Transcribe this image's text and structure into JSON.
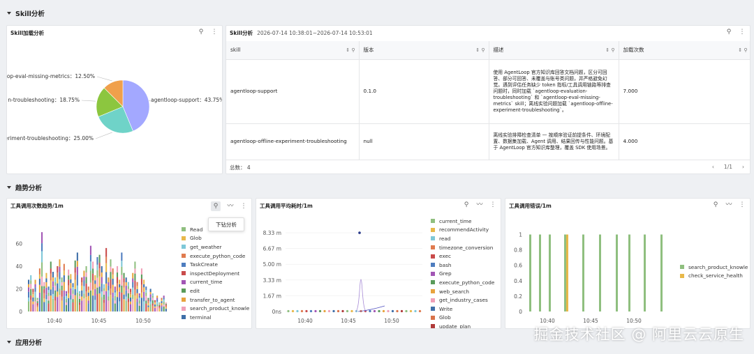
{
  "sections": {
    "skill": "Skill分析",
    "trend": "趋势分析",
    "app": "应用分析"
  },
  "pie_panel": {
    "title": "Skill加载分析"
  },
  "table_panel": {
    "title": "Skill分析",
    "range": "2026-07-14 10:38:01~2026-07-14 10:53:01",
    "columns": [
      "skill",
      "版本",
      "描述",
      "加载次数"
    ],
    "rows": [
      {
        "skill": "agentloop-support",
        "version": "0.1.0",
        "desc": "使用 AgentLoop 官方知识库回答文档问题，区分可回答、部分可回答、未覆盖与账号类问题，并严格避免幻觉。遇到评估任务缺少 token 指标/工具调用链路等排查问题时，同时加载 `agentloop-evaluation-troubleshooting` 和 `agentloop-eval-missing-metrics` skill；离线实验问题加载 `agentloop-offline-experiment-troubleshooting`。",
        "count": "7.000"
      },
      {
        "skill": "agentloop-offline-experiment-troubleshooting",
        "version": "null",
        "desc": "离线实验排障检查清单 — 按顺序验证前提条件、环境配置、数据集加载、Agent 调用、结果回传与性能问题。基于 AgentLoop 官方知识库整理，覆盖 SDK 使用场景。",
        "count": "4.000"
      }
    ],
    "total": "总数： 4",
    "page": "1/1"
  },
  "tool_count_panel": {
    "title": "工具调用次数趋势/1m",
    "tooltip": "下钻分析",
    "legend": [
      {
        "name": "Read",
        "color": "#8fbf7f"
      },
      {
        "name": "Glob",
        "color": "#e8b84a"
      },
      {
        "name": "get_weather",
        "color": "#7ec8d8"
      },
      {
        "name": "execute_python_code",
        "color": "#e07b4f"
      },
      {
        "name": "TaskCreate",
        "color": "#4e7dbf"
      },
      {
        "name": "inspectDeployment",
        "color": "#c94b4b"
      },
      {
        "name": "current_time",
        "color": "#a256b5"
      },
      {
        "name": "edit",
        "color": "#5a9b5a"
      },
      {
        "name": "transfer_to_agent",
        "color": "#e8a33d"
      },
      {
        "name": "search_product_knowle",
        "color": "#f0a0b8"
      },
      {
        "name": "terminal",
        "color": "#3f6fa8"
      }
    ]
  },
  "tool_latency_panel": {
    "title": "工具调用平均耗时/1m",
    "legend": [
      {
        "name": "current_time",
        "color": "#8fbf7f"
      },
      {
        "name": "recommendActivity",
        "color": "#e8b84a"
      },
      {
        "name": "read",
        "color": "#7ec8d8"
      },
      {
        "name": "timezone_conversion",
        "color": "#e07b4f"
      },
      {
        "name": "exec",
        "color": "#c94b4b"
      },
      {
        "name": "bash",
        "color": "#4e7dbf"
      },
      {
        "name": "Grep",
        "color": "#a256b5"
      },
      {
        "name": "execute_python_code",
        "color": "#5a9b5a"
      },
      {
        "name": "web_search",
        "color": "#e8a33d"
      },
      {
        "name": "get_industry_cases",
        "color": "#f0a0b8"
      },
      {
        "name": "Write",
        "color": "#3f6fa8"
      },
      {
        "name": "Glob",
        "color": "#d9734a"
      },
      {
        "name": "update_plan",
        "color": "#b03a3a"
      }
    ]
  },
  "tool_error_panel": {
    "title": "工具调用错误/1m",
    "legend": [
      {
        "name": "search_product_knowle",
        "color": "#8fbf7f"
      },
      {
        "name": "check_service_health",
        "color": "#e8b84a"
      }
    ]
  },
  "icons": [
    "drilldown-icon",
    "chart-type-icon",
    "more-icon",
    "sort-icon",
    "filter-icon",
    "chevron-left-icon",
    "chevron-right-icon"
  ],
  "watermark": "掘金技术社区 @ 阿里云云原生",
  "chart_data": [
    {
      "type": "pie",
      "categories": [
        "agentloop-support",
        "agentloop-offline-experiment-troubleshooting",
        "agentloop-evaluation-troubleshooting",
        "agentloop-eval-missing-metrics"
      ],
      "values": [
        43.75,
        25.0,
        18.75,
        12.5
      ],
      "labels": [
        "agentloop-support：43.75%",
        "experiment-troubleshooting：25.00%",
        "n-troubleshooting：18.75%",
        "op-eval-missing-metrics：12.50%"
      ],
      "colors": [
        "#a3a8ff",
        "#6fd3c8",
        "#8cc63f",
        "#f0a04b"
      ]
    },
    {
      "type": "bar",
      "stacked": true,
      "x_ticks": [
        "10:40",
        "10:45",
        "10:50"
      ],
      "y_ticks": [
        "0",
        "20",
        "40",
        "60"
      ],
      "ylim": [
        0,
        75
      ],
      "totals": [
        28,
        32,
        20,
        28,
        12,
        38,
        70,
        26,
        34,
        22,
        44,
        35,
        30,
        40,
        46,
        30,
        42,
        18,
        37,
        33,
        25,
        45,
        52,
        18,
        30,
        36,
        40,
        22,
        58,
        44,
        32,
        48,
        50,
        40,
        24,
        56,
        30,
        46,
        38,
        22,
        40,
        28,
        52,
        34,
        30,
        26,
        20,
        34,
        44,
        26,
        16,
        38,
        28,
        22,
        12,
        20,
        16,
        10,
        14,
        8,
        12,
        14,
        8
      ]
    },
    {
      "type": "line",
      "x_ticks": [
        "10:40",
        "10:45",
        "10:50"
      ],
      "y_ticks": [
        "0ns",
        "1.67 m",
        "3.33 m",
        "5.00 m",
        "6.67 m",
        "8.33 m"
      ],
      "ylim": [
        0,
        9
      ],
      "spike_value": 3.4,
      "outlier_value": 8.33
    },
    {
      "type": "bar",
      "x_ticks": [
        "10:40",
        "10:45",
        "10:50"
      ],
      "y_ticks": [
        "0",
        "0.2",
        "0.4",
        "0.6",
        "0.8",
        "1"
      ],
      "ylim": [
        0,
        1.05
      ],
      "series": [
        {
          "name": "search_product_knowle",
          "values": [
            1,
            1,
            1,
            1,
            1,
            1,
            1,
            1,
            1,
            1
          ]
        },
        {
          "name": "check_service_health",
          "values": [
            1
          ]
        }
      ]
    }
  ]
}
